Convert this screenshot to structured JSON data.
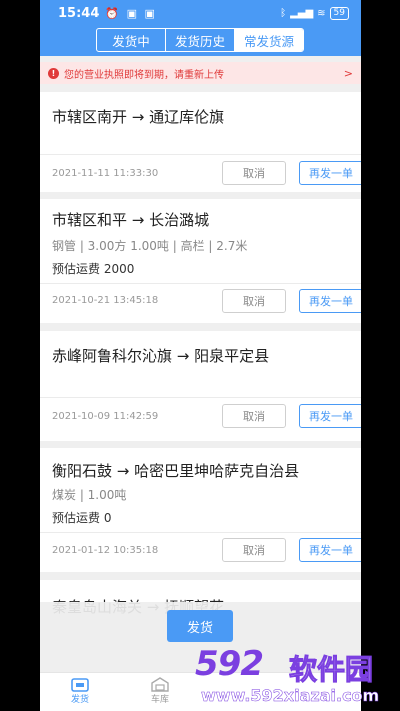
{
  "status_bar": {
    "time": "15:44",
    "battery": "59"
  },
  "tabs": [
    {
      "label": "发货中"
    },
    {
      "label": "发货历史"
    },
    {
      "label": "常发货源"
    }
  ],
  "notice": {
    "text": "您的营业执照即将到期，请重新上传",
    "chevron": ">"
  },
  "cards": [
    {
      "route": "市辖区南开 → 通辽库伦旗",
      "spec": "",
      "fee": "",
      "date": "2021-11-11 11:33:30",
      "cancel_label": "取消",
      "repost_label": "再发一单"
    },
    {
      "route": "市辖区和平 → 长治潞城",
      "spec": "钢管 | 3.00方 1.00吨 | 高栏 | 2.7米",
      "fee": "预估运费 2000",
      "date": "2021-10-21 13:45:18",
      "cancel_label": "取消",
      "repost_label": "再发一单"
    },
    {
      "route": "赤峰阿鲁科尔沁旗 → 阳泉平定县",
      "spec": "",
      "fee": "",
      "date": "2021-10-09 11:42:59",
      "cancel_label": "取消",
      "repost_label": "再发一单"
    },
    {
      "route": "衡阳石鼓 → 哈密巴里坤哈萨克自治县",
      "spec": "煤炭 | 1.00吨",
      "fee": "预估运费 0",
      "date": "2021-01-12 10:35:18",
      "cancel_label": "取消",
      "repost_label": "再发一单"
    }
  ],
  "partial_route": "秦皇岛山海关 → 抚顺望花",
  "ship_button": "发货",
  "bottom_nav": [
    {
      "label": "发货",
      "icon": "ship-icon",
      "active": true
    },
    {
      "label": "车库",
      "icon": "garage-icon",
      "active": false
    }
  ],
  "watermark": {
    "logo": "592",
    "text": "软件园",
    "url": "www.592xiazai.com"
  },
  "colors": {
    "primary": "#4a9af5",
    "warning": "#e03a3a",
    "watermark": "#7b3fe0"
  }
}
